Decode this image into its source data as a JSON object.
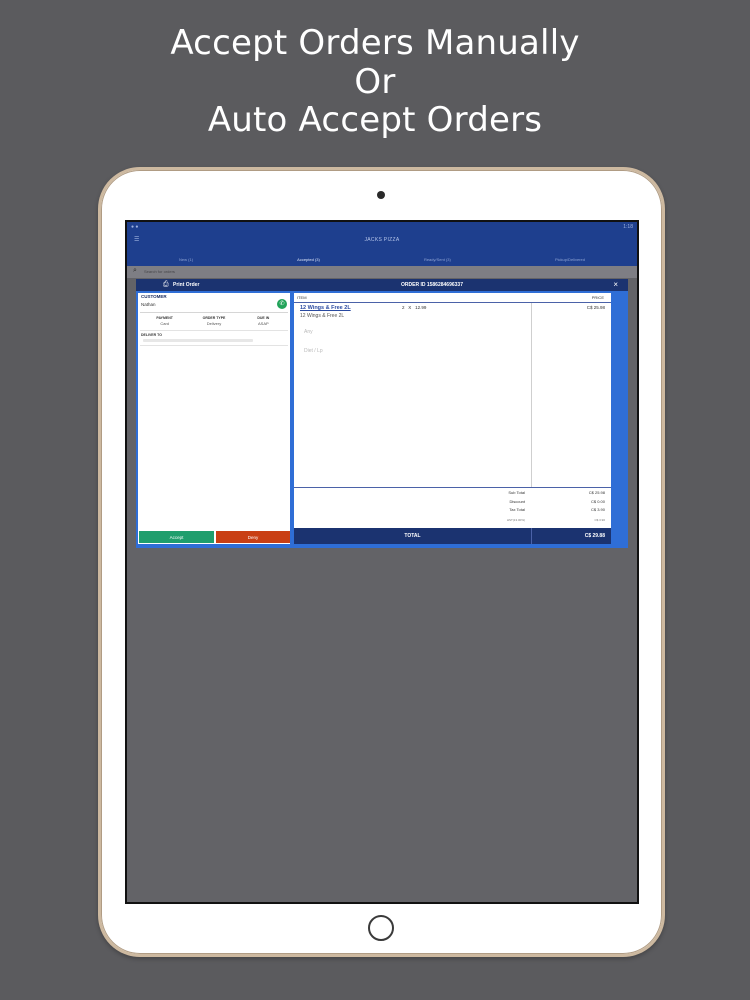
{
  "headline": {
    "line1": "Accept Orders Manually",
    "line2": "Or",
    "line3": "Auto Accept Orders"
  },
  "app": {
    "status_left": "● ●",
    "status_right": "1:18",
    "title": "JACKS PIZZA",
    "tabs": [
      {
        "label": "New (1)"
      },
      {
        "label": "Accepted (3)"
      },
      {
        "label": "Ready/Sent (3)"
      },
      {
        "label": "Pickup/Delivered"
      }
    ],
    "search_placeholder": "Search for orders"
  },
  "modal": {
    "print_label": "Print Order",
    "order_id_label": "ORDER ID 1586284696337",
    "close_glyph": "×",
    "customer": {
      "title": "CUSTOMER",
      "name": "Nathan"
    },
    "info": [
      {
        "label": "PAYMENT",
        "value": "Card"
      },
      {
        "label": "ORDER TYPE",
        "value": "Delivery"
      },
      {
        "label": "DUE IN",
        "value": "ASAP"
      }
    ],
    "deliver_to_label": "DELIVER TO",
    "accept_label": "Accept",
    "deny_label": "Deny",
    "columns": {
      "item": "ITEM",
      "price": "PRICE"
    },
    "items": [
      {
        "name": "12 Wings & Free 2L",
        "qty": "2",
        "x": "X",
        "unit_price": "12.99",
        "price": "C$ 25.98",
        "sub": "12 Wings & Free 2L"
      }
    ],
    "modifiers": [
      "Any",
      "Diet / Lp"
    ],
    "totals": [
      {
        "label": "Sub Total",
        "value": "C$ 25.98"
      },
      {
        "label": "Discount",
        "value": "C$ 0.00"
      },
      {
        "label": "Tax Total",
        "value": "C$ 3.90"
      },
      {
        "label": "HST(13.00%)",
        "value": "C$ 3.90"
      }
    ],
    "grand_total_label": "TOTAL",
    "grand_total_value": "C$ 29.88"
  },
  "colors": {
    "accept": "#1f9e6d",
    "deny": "#c93f14",
    "header_navy": "#1b3370",
    "accent_blue": "#2f6ed6"
  },
  "icons": {
    "print": "printer-icon",
    "phone": "phone-icon",
    "close": "close-icon",
    "search": "search-icon"
  }
}
